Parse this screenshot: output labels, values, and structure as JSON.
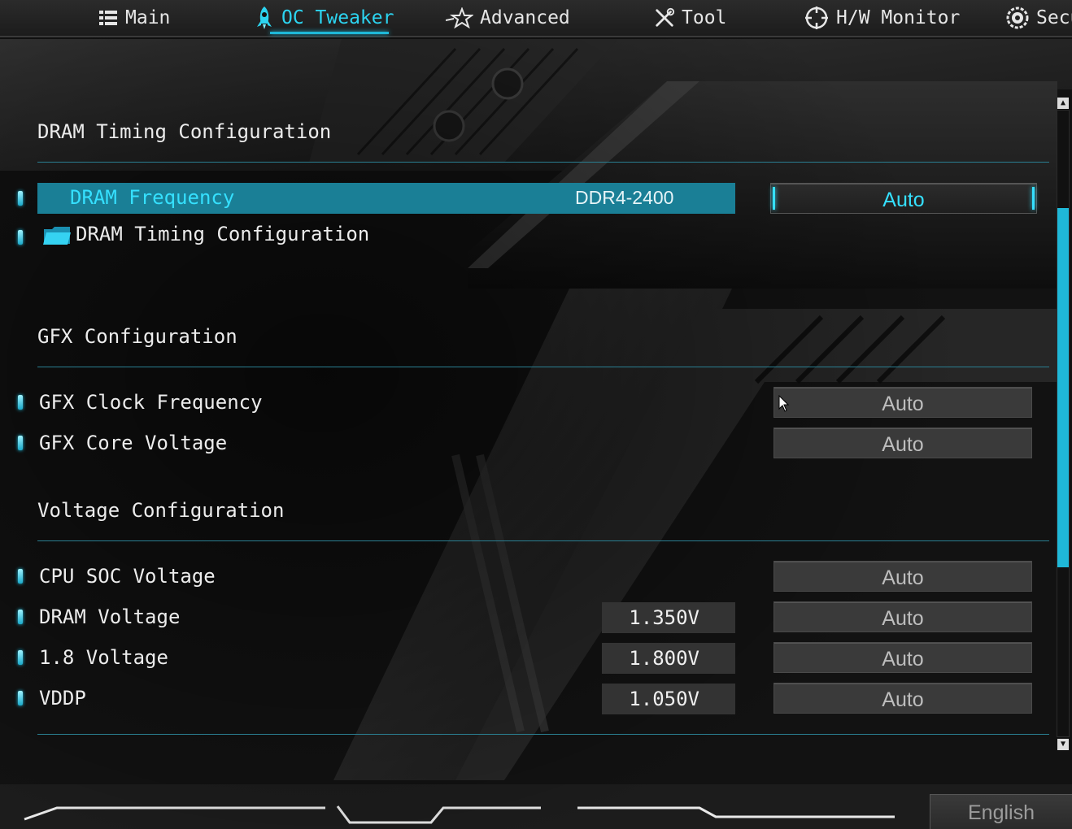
{
  "nav": {
    "tabs": [
      {
        "label": "Main",
        "icon": "list-icon",
        "active": false
      },
      {
        "label": "OC Tweaker",
        "icon": "rocket-icon",
        "active": true
      },
      {
        "label": "Advanced",
        "icon": "star-icon",
        "active": false
      },
      {
        "label": "Tool",
        "icon": "wrench-screwdriver-icon",
        "active": false
      },
      {
        "label": "H/W Monitor",
        "icon": "crosshair-icon",
        "active": false
      },
      {
        "label": "Secu",
        "icon": "shield-gear-icon",
        "active": false
      }
    ]
  },
  "dram": {
    "section_title": "DRAM Timing Configuration",
    "frequency_label": "DRAM Frequency",
    "frequency_value": "DDR4-2400",
    "frequency_setting": "Auto",
    "timing_submenu_label": "DRAM Timing Configuration"
  },
  "gfx": {
    "section_title": "GFX Configuration",
    "clock_label": "GFX Clock Frequency",
    "clock_setting": "Auto",
    "voltage_label": "GFX Core Voltage",
    "voltage_setting": "Auto"
  },
  "voltage": {
    "section_title": "Voltage Configuration",
    "rows": [
      {
        "label": "CPU SOC Voltage",
        "value": "",
        "setting": "Auto"
      },
      {
        "label": "DRAM Voltage",
        "value": "1.350V",
        "setting": "Auto"
      },
      {
        "label": "1.8 Voltage",
        "value": "1.800V",
        "setting": "Auto"
      },
      {
        "label": "VDDP",
        "value": "1.050V",
        "setting": "Auto"
      }
    ]
  },
  "footer": {
    "language": "English"
  },
  "colors": {
    "accent": "#1fb8d8",
    "highlight": "#1a7f96",
    "accent_text": "#35e0ff"
  }
}
